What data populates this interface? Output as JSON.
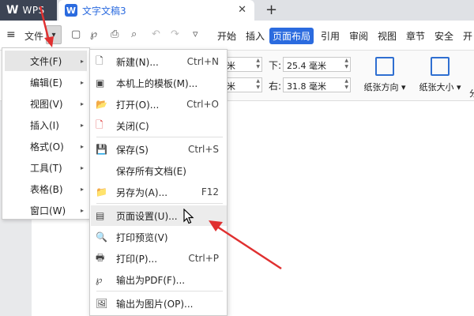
{
  "titlebar": {
    "app_logo": "W",
    "app_name": "WPS",
    "doc_icon": "W",
    "doc_tab": "文字文稿3",
    "close_icon": "close-icon",
    "new_tab": "+"
  },
  "toolbar": {
    "menu_glyph": "≡",
    "file_label": "文件",
    "dropdown_glyph": "▾",
    "ribbon_tabs": [
      "开始",
      "插入",
      "页面布局",
      "引用",
      "审阅",
      "视图",
      "章节",
      "安全",
      "开"
    ],
    "active_tab": "页面布局"
  },
  "ribbon": {
    "left_top_value": "米",
    "left_bottom_value": "米",
    "bottom_label": "下:",
    "bottom_value": "25.4 毫米",
    "right_label": "右:",
    "right_value": "31.8 毫米",
    "orientation_label": "纸张方向",
    "size_label": "纸张大小",
    "extra_label": "分"
  },
  "menu_left": {
    "items": [
      {
        "label": "文件(F)"
      },
      {
        "label": "编辑(E)"
      },
      {
        "label": "视图(V)"
      },
      {
        "label": "插入(I)"
      },
      {
        "label": "格式(O)"
      },
      {
        "label": "工具(T)"
      },
      {
        "label": "表格(B)"
      },
      {
        "label": "窗口(W)"
      }
    ],
    "arrow": "▸"
  },
  "submenu": {
    "items": [
      {
        "label": "新建(N)...",
        "shortcut": "Ctrl+N",
        "icon": "new-doc-icon",
        "glyph": "🗋"
      },
      {
        "label": "本机上的模板(M)...",
        "shortcut": "",
        "icon": "template-icon",
        "glyph": "▣"
      },
      {
        "label": "打开(O)...",
        "shortcut": "Ctrl+O",
        "icon": "open-folder-icon",
        "glyph": "📂"
      },
      {
        "label": "关闭(C)",
        "shortcut": "",
        "icon": "close-doc-icon",
        "glyph": "🗋"
      },
      {
        "label": "保存(S)",
        "shortcut": "Ctrl+S",
        "icon": "save-icon",
        "glyph": "💾"
      },
      {
        "label": "保存所有文档(E)",
        "shortcut": "",
        "icon": "",
        "glyph": ""
      },
      {
        "label": "另存为(A)...",
        "shortcut": "F12",
        "icon": "save-as-icon",
        "glyph": "📁"
      },
      {
        "label": "页面设置(U)...",
        "shortcut": "",
        "icon": "page-setup-icon",
        "glyph": "▤"
      },
      {
        "label": "打印预览(V)",
        "shortcut": "",
        "icon": "print-preview-icon",
        "glyph": "🔍"
      },
      {
        "label": "打印(P)...",
        "shortcut": "Ctrl+P",
        "icon": "print-icon",
        "glyph": "🖶"
      },
      {
        "label": "输出为PDF(F)...",
        "shortcut": "",
        "icon": "pdf-icon",
        "glyph": "℘"
      },
      {
        "label": "输出为图片(OP)...",
        "shortcut": "",
        "icon": "image-export-icon",
        "glyph": "🖼"
      }
    ]
  }
}
